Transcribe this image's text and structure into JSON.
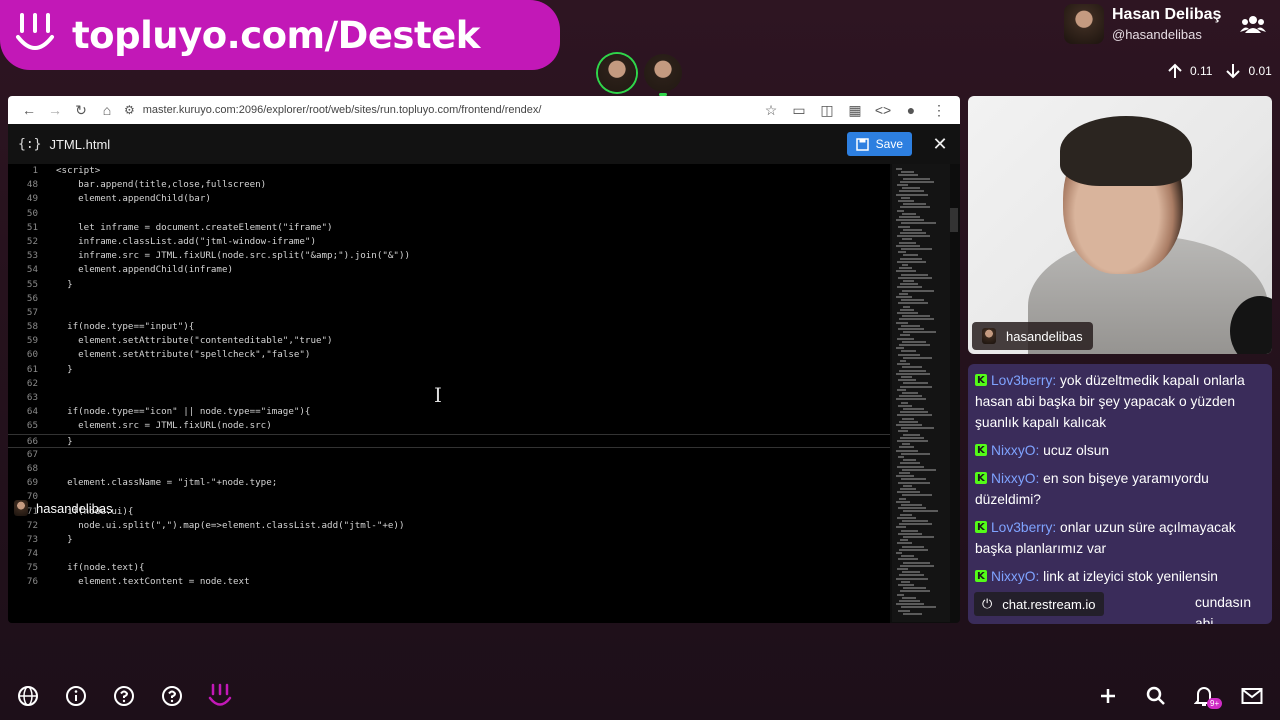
{
  "brand": {
    "text": "topluyo.com/Destek",
    "color": "#c218b7"
  },
  "profile": {
    "name": "Hasan Delibaş",
    "handle": "@hasandelibas"
  },
  "stats": {
    "up": "0.11",
    "down": "0.01"
  },
  "browser": {
    "url": "master.kuruyo.com:2096/explorer/root/web/sites/run.topluyo.com/frontend/rendex/",
    "file_name": "JTML.html",
    "save_label": "Save"
  },
  "code_lines": [
    {
      "n": "1",
      "t": "<script>"
    },
    {
      "n": "48",
      "t": "    bar.append(title,close,fullscreen)"
    },
    {
      "n": "49",
      "t": "    element.appendChild(bar)"
    },
    {
      "n": "50",
      "t": ""
    },
    {
      "n": "51",
      "t": "    let inframe = document.createElement(\"iframe\")"
    },
    {
      "n": "52",
      "t": "    inframe.classList.add(\"jtml-window-iframe\")"
    },
    {
      "n": "53",
      "t": "    inframe.src = JTML.fixURL(node.src.split(\"&amp;\").join(\"&\"))"
    },
    {
      "n": "54",
      "t": "    element.appendChild(inframe)"
    },
    {
      "n": "55",
      "t": "  }"
    },
    {
      "n": "56",
      "t": ""
    },
    {
      "n": "57",
      "t": ""
    },
    {
      "n": "58",
      "t": "  if(node.type==\"input\"){"
    },
    {
      "n": "59",
      "t": "    element.setAttribute(\"contenteditable\",\"true\")"
    },
    {
      "n": "60",
      "t": "    element.setAttribute(\"spellcheck\",\"false\")"
    },
    {
      "n": "61",
      "t": "  }"
    },
    {
      "n": "62",
      "t": ""
    },
    {
      "n": "63",
      "t": ""
    },
    {
      "n": "64",
      "t": "  if(node.type==\"icon\" || node.type==\"image\"){"
    },
    {
      "n": "65",
      "t": "    element.src = JTML.fixURL(node.src)"
    },
    {
      "n": "66",
      "t": "  }"
    },
    {
      "n": "67",
      "t": ""
    },
    {
      "n": "68",
      "t": ""
    },
    {
      "n": "69",
      "t": "  element.className = \"jtml-\"+node.type;"
    },
    {
      "n": "70",
      "t": ""
    },
    {
      "n": "71",
      "t": "  if(node.ui){"
    },
    {
      "n": "72",
      "t": "    node.ui.split(\",\").map(e=>element.classList.add(\"jtml-\"+e))"
    },
    {
      "n": "73",
      "t": "  }"
    },
    {
      "n": "74",
      "t": ""
    },
    {
      "n": "75",
      "t": "  if(node.text){"
    },
    {
      "n": "76",
      "t": "    element.textContent = node.text"
    }
  ],
  "editor_user": "hasandelibas",
  "cam_label": "hasandelibas",
  "chat": [
    {
      "user": "Lov3berry:",
      "text": "yok düzeltmedik kapalı onlarla hasan abi başka bir şey yapacak o yüzden şuanlık kapalı kalıcak"
    },
    {
      "user": "NixxyO:",
      "text": "ucuz olsun"
    },
    {
      "user": "NixxyO:",
      "text": "en son bişeye yaramıyordu düzeldimi?"
    },
    {
      "user": "Lov3berry:",
      "text": "onlar uzun süre açılmayacak başka planlarımız var"
    },
    {
      "user": "NixxyO:",
      "text": "link at izleyici stok yenilensin"
    },
    {
      "user": "",
      "text": "cundasın abi"
    }
  ],
  "restream_label": "chat.restream.io",
  "notification_badge": "9+",
  "icons": [
    "globe-icon",
    "info-icon",
    "help-icon",
    "help-alt-icon",
    "topluyo-logo-icon",
    "plus-icon",
    "search-icon",
    "bell-icon",
    "mail-icon"
  ]
}
